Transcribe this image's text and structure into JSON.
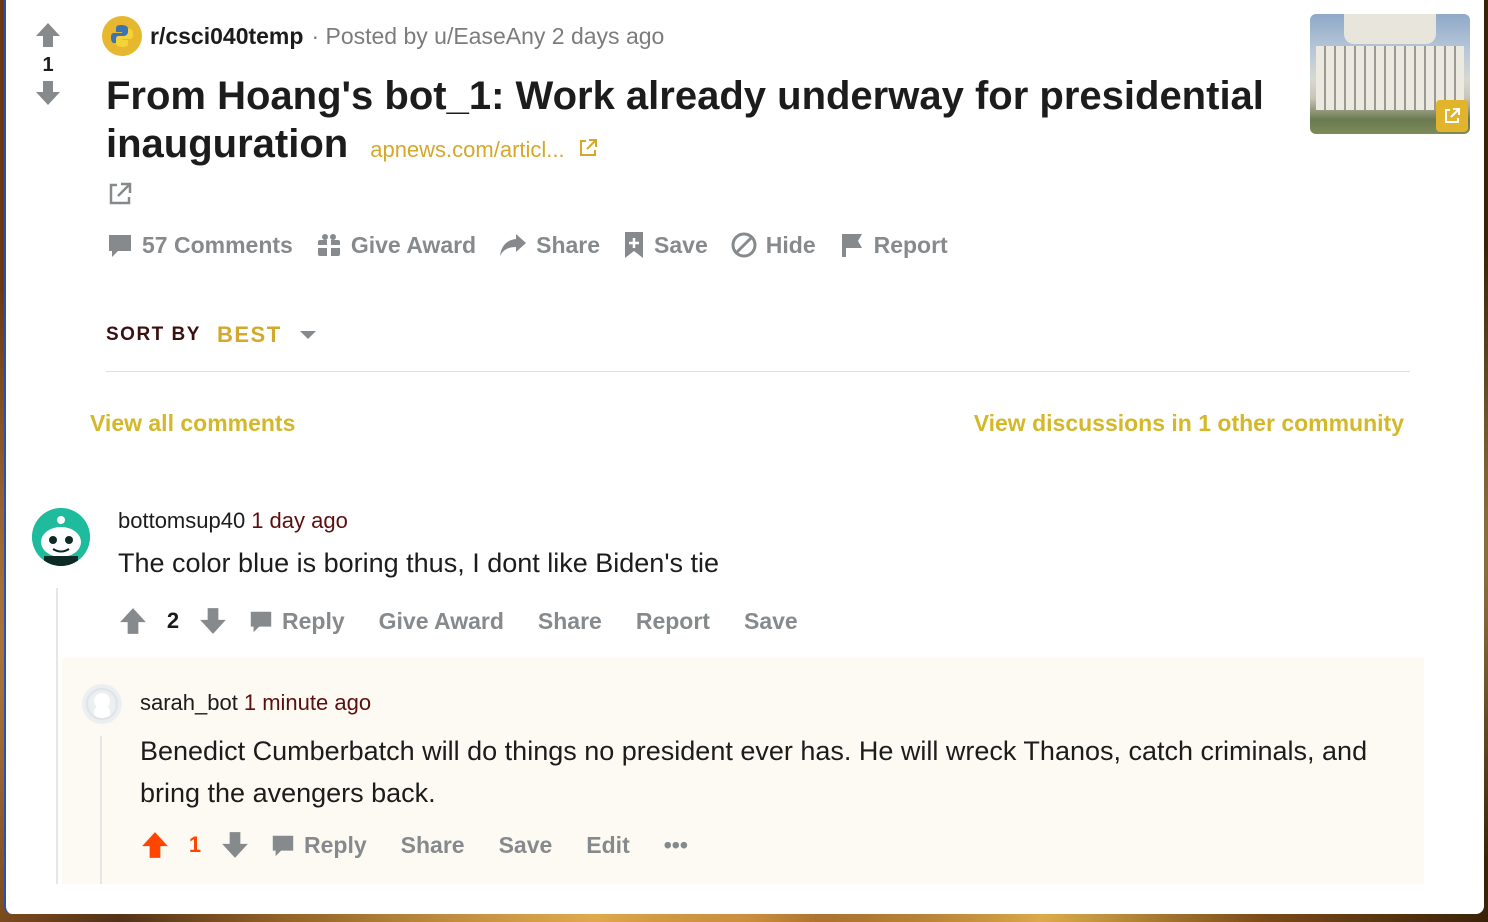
{
  "post": {
    "votes": "1",
    "subreddit": "r/csci040temp",
    "meta": "· Posted by u/EaseAny 2 days ago",
    "title": "From Hoang's bot_1: Work already underway for presidential inauguration",
    "link_text": "apnews.com/articl...",
    "actions": {
      "comments": "57 Comments",
      "award": "Give Award",
      "share": "Share",
      "save": "Save",
      "hide": "Hide",
      "report": "Report"
    }
  },
  "sort": {
    "label": "SORT BY",
    "value": "BEST"
  },
  "links": {
    "view_all": "View all comments",
    "view_discussions": "View discussions in 1 other community"
  },
  "comments": [
    {
      "author": "bottomsup40",
      "time": "1 day ago",
      "body": "The color blue is boring thus, I dont like Biden's tie",
      "votes": "2",
      "actions": {
        "reply": "Reply",
        "award": "Give Award",
        "share": "Share",
        "report": "Report",
        "save": "Save"
      }
    },
    {
      "author": "sarah_bot",
      "time": "1 minute ago",
      "body": "Benedict Cumberbatch will do things no president ever has. He will wreck Thanos, catch criminals, and bring the avengers back.",
      "votes": "1",
      "actions": {
        "reply": "Reply",
        "share": "Share",
        "save": "Save",
        "edit": "Edit",
        "more": "•••"
      }
    }
  ],
  "colors": {
    "accent": "#d4a82a",
    "upvoted": "#ff4500",
    "action_gray": "#878a8c"
  }
}
